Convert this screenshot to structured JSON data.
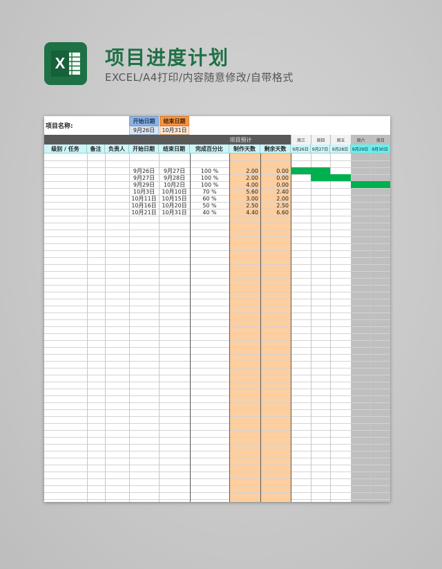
{
  "header": {
    "title": "项目进度计划",
    "subtitle": "EXCEL/A4打印/内容随意修改/自带格式",
    "logo_icon": "excel-icon",
    "logo_letter": "X"
  },
  "colors": {
    "accent_green": "#1e7145",
    "start_header": "#8db4e2",
    "end_header": "#f79646",
    "dark_band": "#595959",
    "col_header_bg": "#ccf5f9",
    "weekend_header_bg": "#66f0f0",
    "orange_column": "#fdce9f",
    "weekend_column": "#bfbfbf",
    "gantt_bar": "#00b050"
  },
  "sheet": {
    "project_name_label": "项目名称:",
    "start_date_label": "开始日期",
    "end_date_label": "结束日期",
    "start_date_value": "9月26日",
    "end_date_value": "10月31日",
    "estimate_label": "项目预计",
    "columns": [
      "级别 / 任务",
      "备注",
      "负责人",
      "开始日期",
      "结束日期",
      "完成百分比",
      "制作天数",
      "剩余天数"
    ],
    "weekdays": [
      "周三",
      "周四",
      "周五",
      "周六",
      "周日"
    ],
    "dates": [
      "9月26日",
      "9月27日",
      "9月28日",
      "9月29日",
      "9月30日"
    ],
    "rows": [
      {
        "start": "9月26日",
        "end": "9月27日",
        "pct": "100 %",
        "days": "2.00",
        "remain": "0.00"
      },
      {
        "start": "9月27日",
        "end": "9月28日",
        "pct": "100 %",
        "days": "2.00",
        "remain": "0.00"
      },
      {
        "start": "9月29日",
        "end": "10月2日",
        "pct": "100 %",
        "days": "4.00",
        "remain": "0.00"
      },
      {
        "start": "10月3日",
        "end": "10月10日",
        "pct": "70 %",
        "days": "5.60",
        "remain": "2.40"
      },
      {
        "start": "10月11日",
        "end": "10月15日",
        "pct": "60 %",
        "days": "3.00",
        "remain": "2.00"
      },
      {
        "start": "10月16日",
        "end": "10月20日",
        "pct": "50 %",
        "days": "2.50",
        "remain": "2.50"
      },
      {
        "start": "10月21日",
        "end": "10月31日",
        "pct": "40 %",
        "days": "4.40",
        "remain": "6.60"
      }
    ],
    "gantt": [
      {
        "row": 0,
        "from_day": 0,
        "to_day": 1
      },
      {
        "row": 1,
        "from_day": 1,
        "to_day": 2
      },
      {
        "row": 2,
        "from_day": 3,
        "to_day": 4
      }
    ]
  }
}
